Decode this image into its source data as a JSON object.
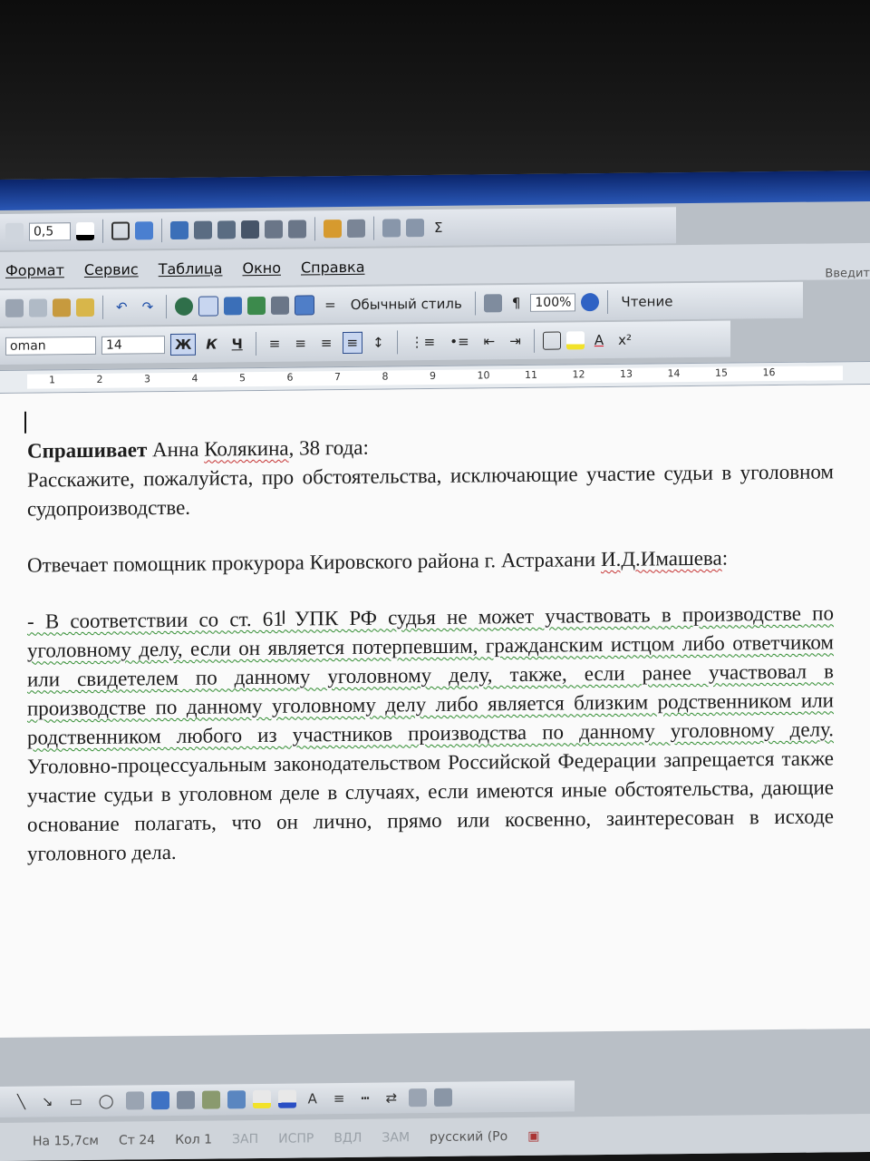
{
  "toolbar_top": {
    "line_width": "0,5"
  },
  "menu": {
    "items": [
      "Формат",
      "Сервис",
      "Таблица",
      "Окно",
      "Справка"
    ]
  },
  "search_placeholder": "Введит",
  "toolbar_standard": {
    "style": "Обычный стиль",
    "zoom": "100%",
    "reading_label": "Чтение"
  },
  "toolbar_format": {
    "font": "oman",
    "size": "14",
    "bold": "Ж",
    "italic": "К",
    "underline": "Ч",
    "superscript": "x²"
  },
  "ruler": {
    "ticks": [
      "1",
      "2",
      "3",
      "4",
      "5",
      "6",
      "7",
      "8",
      "9",
      "10",
      "11",
      "12",
      "13",
      "14",
      "15",
      "16"
    ]
  },
  "document": {
    "asker_label": "Спрашивает",
    "asker_name": "Анна",
    "asker_surname": "Колякина",
    "asker_age": ", 38 года:",
    "question": "Расскажите, пожалуйста, про обстоятельства, исключающие участие судьи в уголовном судопроизводстве.",
    "answer_intro": "Отвечает помощник прокурора Кировского района г. Астрахани ",
    "answer_name": "И.Д.Имашева",
    "answer_colon": ":",
    "answer_body": "- В соответствии со ст. 61 УПК РФ судья не может участвовать в производстве по уголовному делу, если он является потерпевшим, гражданским истцом либо ответчиком или свидетелем по данному уголовному делу, также, если ранее участвовал в производстве по данному уголовному делу либо является близким родственником или родственником любого из участников производства по данному уголовному делу.",
    "answer_body_2": " Уголовно-процессуальным законодательством Российской Федерации запрещается также участие судьи в уголовном деле в случаях, если имеются иные обстоятельства, дающие основание полагать, что он лично, прямо или косвенно, заинтересован в исходе уголовного дела."
  },
  "status": {
    "position": "На 15,7см",
    "line": "Ст 24",
    "column": "Кол 1",
    "rec": "ЗАП",
    "trk": "ИСПР",
    "ext": "ВДЛ",
    "ovr": "ЗАМ",
    "language": "русский (Ро"
  }
}
